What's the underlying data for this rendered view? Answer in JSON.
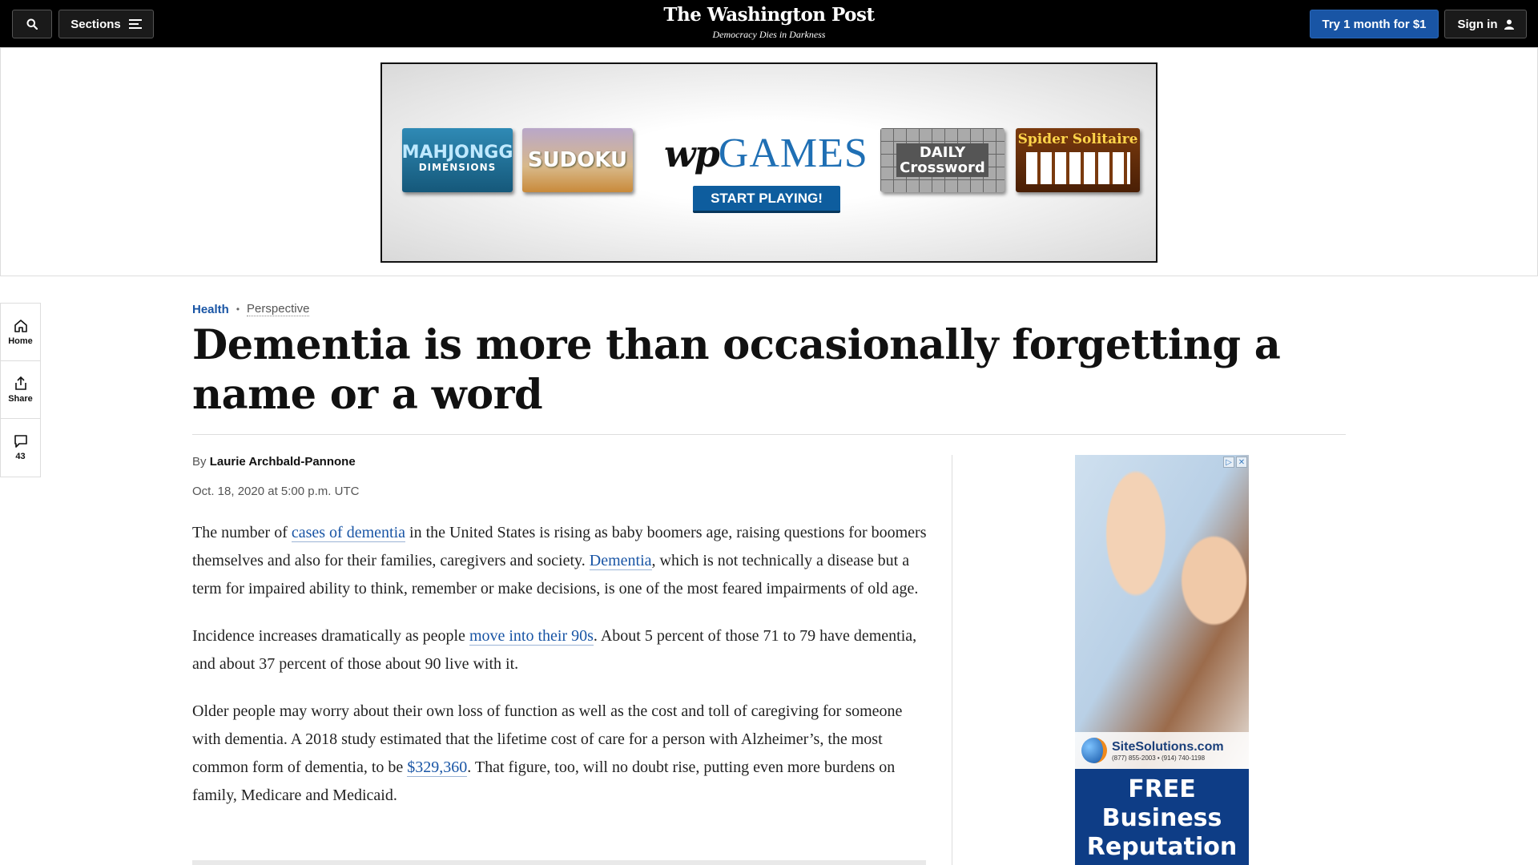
{
  "topbar": {
    "search_icon": "search-icon",
    "sections_label": "Sections",
    "sections_icon": "hamburger-menu-icon",
    "masthead": "The Washington Post",
    "tagline": "Democracy Dies in Darkness",
    "try_label": "Try 1 month for $1",
    "signin_label": "Sign in",
    "signin_icon": "user-icon"
  },
  "ad_banner": {
    "tiles": [
      "MAHJONGG",
      "DIMENSIONS",
      "SUDOKU",
      "DAILY",
      "Crossword",
      "Spider Solitaire"
    ],
    "logo_mark": "wp",
    "logo_word": "GAMES",
    "cta": "START PLAYING!"
  },
  "rail": {
    "home": "Home",
    "share": "Share",
    "comments_count": "43"
  },
  "article": {
    "section": "Health",
    "label": "Perspective",
    "headline": "Dementia is more than occasionally forgetting a name or a word",
    "by": "By",
    "author": "Laurie Archbald-Pannone",
    "timestamp": "Oct. 18, 2020 at 5:00 p.m. UTC",
    "p1": {
      "t1": "The number of ",
      "l1": "cases of dementia",
      "t2": " in the United States is rising as baby boomers age, raising questions for boomers themselves and also for their families, caregivers and society. ",
      "l2": "Dementia",
      "t3": ", which is not technically a disease but a term for impaired ability to think, remember or make decisions, is one of the most feared impairments of old age."
    },
    "p2": {
      "t1": "Incidence increases dramatically as people ",
      "l1": "move into their 90s",
      "t2": ". About 5 percent of those 71 to 79 have dementia, and about 37 percent of those about 90 live with it."
    },
    "p3": {
      "t1": "Older people may worry about their own loss of function as well as the cost and toll of caregiving for someone with dementia. A 2018 study estimated that the lifetime cost of care for a person with Alzheimer’s, the most common form of dementia, to be ",
      "l1": "$329,360",
      "t2": ". That figure, too, will no doubt rise, putting even more burdens on family, Medicare and Medicaid."
    }
  },
  "side_ad": {
    "brand": "SiteSolutions.com",
    "phone": "(877) 855-2003 • (914) 740-1198",
    "headline_lines": [
      "FREE",
      "Business",
      "Reputation"
    ]
  }
}
